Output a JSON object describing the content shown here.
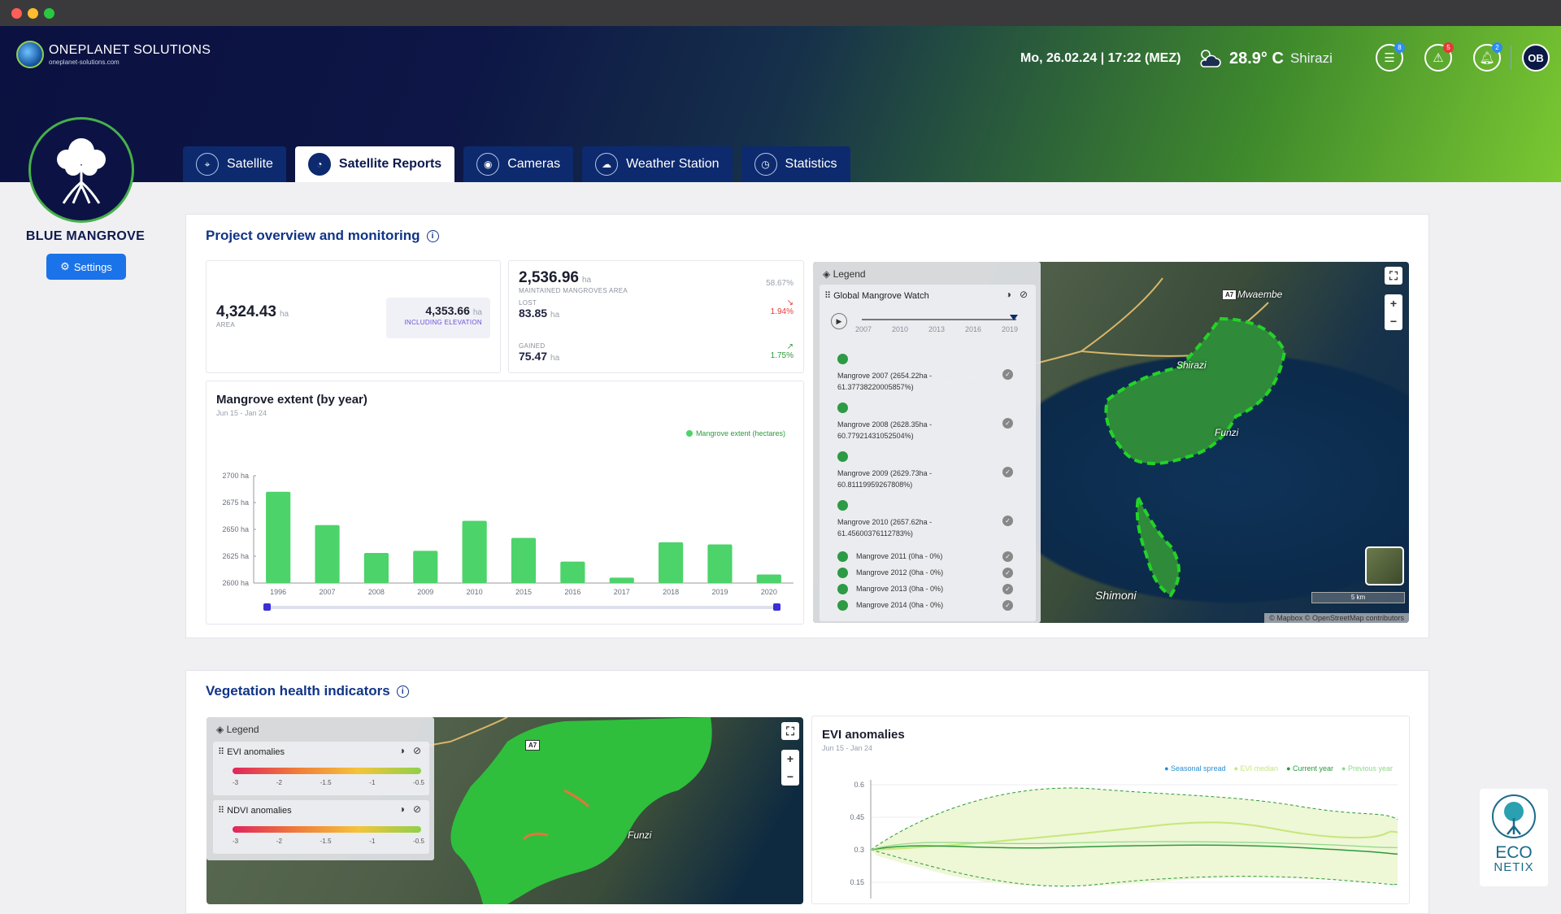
{
  "header": {
    "brand": "ONEPLANET SOLUTIONS",
    "brand_sub": "oneplanet-solutions.com",
    "datetime": "Mo, 26.02.24 | 17:22 (MEZ)",
    "temperature": "28.9° C",
    "location": "Shirazi",
    "tasks_badge": "8",
    "alerts_badge": "5",
    "notifications_badge": "2",
    "user_initials": "OB",
    "colors": {
      "badge_blue": "#2e8bf0",
      "badge_red": "#e53935"
    }
  },
  "project": {
    "name": "BLUE MANGROVE",
    "settings_label": "Settings"
  },
  "tabs": [
    {
      "label": "Satellite",
      "icon": "map-pin-icon"
    },
    {
      "label": "Satellite Reports",
      "icon": "pie-chart-icon",
      "active": true
    },
    {
      "label": "Cameras",
      "icon": "camera-icon"
    },
    {
      "label": "Weather Station",
      "icon": "weather-icon"
    },
    {
      "label": "Statistics",
      "icon": "statistics-icon"
    }
  ],
  "overview": {
    "title": "Project overview and monitoring",
    "area_value": "4,324.43",
    "area_unit": "ha",
    "area_caption": "AREA",
    "elev_value": "4,353.66",
    "elev_unit": "ha",
    "elev_caption": "INCLUDING ELEVATION",
    "maintained_value": "2,536.96",
    "maintained_unit": "ha",
    "maintained_caption": "MAINTAINED MANGROVES AREA",
    "maintained_pct": "58.67%",
    "lost_caption": "LOST",
    "lost_value": "83.85",
    "lost_unit": "ha",
    "lost_pct": "1.94%",
    "gained_caption": "GAINED",
    "gained_value": "75.47",
    "gained_unit": "ha",
    "gained_pct": "1.75%"
  },
  "extent_chart": {
    "title": "Mangrove extent (by year)",
    "subtitle": "Jun 15 - Jan 24",
    "legend": "Mangrove extent (hectares)"
  },
  "chart_data": [
    {
      "type": "bar",
      "title": "Mangrove extent (by year)",
      "categories": [
        "1996",
        "2007",
        "2008",
        "2009",
        "2010",
        "2015",
        "2016",
        "2017",
        "2018",
        "2019",
        "2020"
      ],
      "series": [
        {
          "name": "Mangrove extent (hectares)",
          "values": [
            2685,
            2654,
            2628,
            2630,
            2658,
            2642,
            2620,
            2605,
            2638,
            2636,
            2608
          ]
        }
      ],
      "ylim": [
        2600,
        2700
      ],
      "yticks": [
        "2700 ha",
        "2675 ha",
        "2650 ha",
        "2625 ha",
        "2600 ha"
      ],
      "color": "#4cd36a"
    },
    {
      "type": "line",
      "title": "EVI anomalies",
      "subtitle": "Jun 15 - Jan 24",
      "yticks": [
        "0.6",
        "0.45",
        "0.3",
        "0.15"
      ],
      "ylim": [
        0.15,
        0.6
      ],
      "legend": [
        "Seasonal spread",
        "EVI median",
        "Current year",
        "Previous year"
      ],
      "colors": {
        "spread": "#2a8fd0",
        "median": "#c8e67a",
        "current": "#2c9a3c",
        "previous": "#8fd88a"
      }
    }
  ],
  "map1": {
    "legend_title": "Legend",
    "layer_name": "Global Mangrove Watch",
    "timeline_years": [
      "2007",
      "2010",
      "2013",
      "2016",
      "2019"
    ],
    "entries": [
      {
        "label": "Mangrove 2007 (2654.22ha - 61.37738220005857%)"
      },
      {
        "label": "Mangrove 2008 (2628.35ha - 60.77921431052504%)"
      },
      {
        "label": "Mangrove 2009 (2629.73ha - 60.81119959267808%)"
      },
      {
        "label": "Mangrove 2010 (2657.62ha - 61.45600376112783%)"
      },
      {
        "label": "Mangrove 2011 (0ha - 0%)"
      },
      {
        "label": "Mangrove 2012 (0ha - 0%)"
      },
      {
        "label": "Mangrove 2013 (0ha - 0%)"
      },
      {
        "label": "Mangrove 2014 (0ha - 0%)"
      }
    ],
    "labels": {
      "road": "A7",
      "mwaembe": "Mwaembe",
      "shirazi": "Shirazi",
      "funzi": "Funzi",
      "shimoni": "Shimoni"
    },
    "scale": "5 km",
    "attribution": "© Mapbox © OpenStreetMap contributors"
  },
  "vegetation": {
    "title": "Vegetation health indicators",
    "legend_title": "Legend",
    "layer1": "EVI anomalies",
    "layer2": "NDVI anomalies",
    "scale_ticks": [
      "-3",
      "-2",
      "-1.5",
      "-1",
      "-0.5"
    ],
    "road": "A7",
    "funzi": "Funzi"
  },
  "evi_chart": {
    "title": "EVI anomalies",
    "subtitle": "Jun 15 - Jan 24",
    "legend": [
      "Seasonal spread",
      "EVI median",
      "Current year",
      "Previous year"
    ]
  },
  "econetix": {
    "line1": "ECO",
    "line2": "NETIX"
  }
}
